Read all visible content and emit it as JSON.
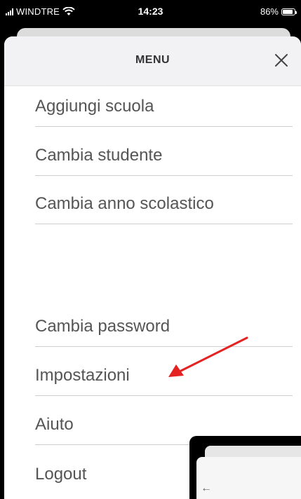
{
  "status_bar": {
    "carrier": "WINDTRE",
    "time": "14:23",
    "battery": "86%",
    "battery_level": 0.86
  },
  "menu": {
    "title": "MENU",
    "close_icon": "close-icon",
    "items": [
      {
        "label": "Aggiungi scuola"
      },
      {
        "label": "Cambia studente"
      },
      {
        "label": "Cambia anno scolastico"
      },
      {
        "label": "Cambia password"
      },
      {
        "label": "Impostazioni"
      },
      {
        "label": "Aiuto"
      },
      {
        "label": "Logout"
      }
    ]
  },
  "annotation": {
    "arrow_color": "#e52222",
    "target": "Impostazioni"
  },
  "preview": {
    "back_icon": "back-arrow-icon"
  },
  "colors": {
    "header_bg": "#f2f2f4",
    "text": "#555555",
    "divider": "#cfcfcf"
  }
}
